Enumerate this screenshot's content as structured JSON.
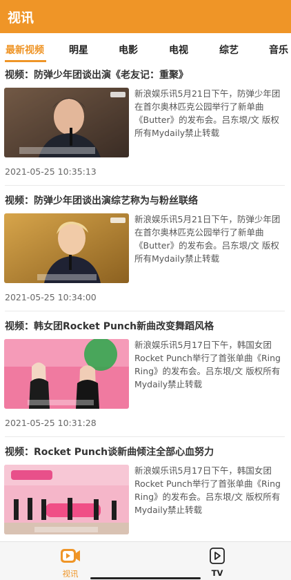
{
  "header": {
    "title": "视讯"
  },
  "tabs": [
    {
      "label": "最新视频",
      "active": true
    },
    {
      "label": "明星"
    },
    {
      "label": "电影"
    },
    {
      "label": "电视"
    },
    {
      "label": "综艺"
    },
    {
      "label": "音乐"
    }
  ],
  "articles": [
    {
      "title": "视频：防弹少年团谈出演《老友记：重聚》",
      "summary": "新浪娱乐讯5月21日下午，防弹少年团在首尔奥林匹克公园举行了新单曲《Butter》的发布会。吕东垠/文 版权所有Mydaily禁止转载",
      "timestamp": "2021-05-25 10:35:13"
    },
    {
      "title": "视频：防弹少年团谈出演综艺称为与粉丝联络",
      "summary": "新浪娱乐讯5月21日下午，防弹少年团在首尔奥林匹克公园举行了新单曲《Butter》的发布会。吕东垠/文 版权所有Mydaily禁止转载",
      "timestamp": "2021-05-25 10:34:00"
    },
    {
      "title": "视频：韩女团Rocket Punch新曲改变舞蹈风格",
      "summary": "新浪娱乐讯5月17日下午，韩国女团Rocket Punch举行了首张单曲《Ring Ring》的发布会。吕东垠/文 版权所有Mydaily禁止转载",
      "timestamp": "2021-05-25 10:31:28"
    },
    {
      "title": "视频：Rocket Punch谈新曲倾注全部心血努力",
      "summary": "新浪娱乐讯5月17日下午，韩国女团Rocket Punch举行了首张单曲《Ring Ring》的发布会。吕东垠/文 版权所有Mydaily禁止转载"
    }
  ],
  "bottom_nav": [
    {
      "label": "视讯",
      "icon": "video-camera-icon",
      "active": true
    },
    {
      "label": "TV",
      "icon": "tv-play-icon"
    }
  ],
  "colors": {
    "accent": "#ef9527"
  }
}
